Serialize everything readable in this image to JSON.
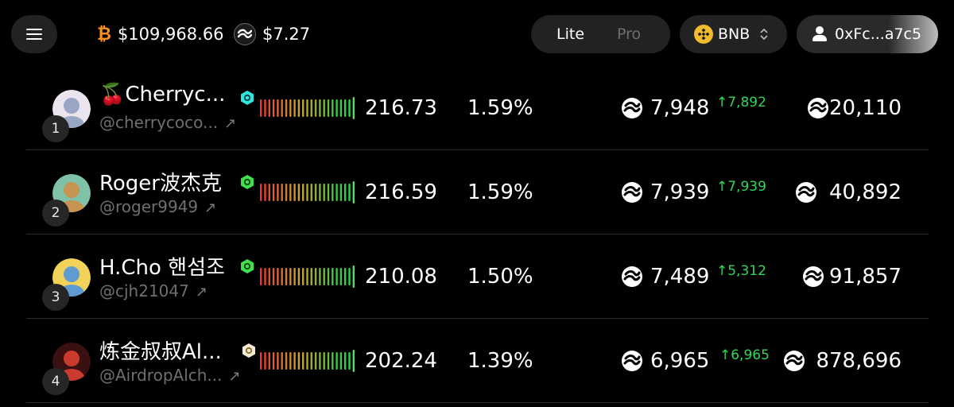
{
  "header": {
    "btc_price": "$109,968.66",
    "token_price": "$7.27",
    "mode_options": [
      "Lite",
      "Pro"
    ],
    "mode_active": "Lite",
    "chain": "BNB",
    "wallet": "0xFc...a7c5"
  },
  "colors": {
    "background": "#000000",
    "surface": "#222224",
    "positive": "#2fd65a",
    "btc": "#f7931a",
    "bnb": "#f3ba2f"
  },
  "rows": [
    {
      "rank": "1",
      "name": "🍒Cherryc...",
      "handle": "@cherrycoco...",
      "badge": "cyan-hex-badge",
      "score": "216.73",
      "share": "1.59%",
      "points": "7,948",
      "delta": "↑7,892",
      "total": "20,110"
    },
    {
      "rank": "2",
      "name": "Roger波杰克",
      "handle": "@roger9949",
      "badge": "green-hex-badge",
      "score": "216.59",
      "share": "1.59%",
      "points": "7,939",
      "delta": "↑7,939",
      "total": "40,892"
    },
    {
      "rank": "3",
      "name": "H.Cho 핸섬조",
      "handle": "@cjh21047",
      "badge": "green-hex-badge",
      "score": "210.08",
      "share": "1.50%",
      "points": "7,489",
      "delta": "↑5,312",
      "total": "91,857"
    },
    {
      "rank": "4",
      "name": "炼金叔叔Al...",
      "handle": "@AirdropAlch...",
      "badge": "cream-hex-badge",
      "score": "202.24",
      "share": "1.39%",
      "points": "6,965",
      "delta": "↑6,965",
      "total": "878,696"
    }
  ]
}
